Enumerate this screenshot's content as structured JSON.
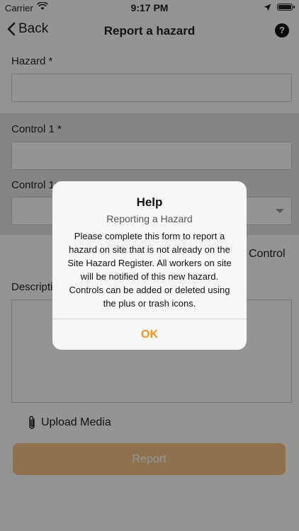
{
  "status_bar": {
    "carrier": "Carrier",
    "time": "9:17 PM"
  },
  "nav": {
    "back_label": "Back",
    "title": "Report a hazard",
    "help_label": "?"
  },
  "form": {
    "hazard_label": "Hazard *",
    "control1_label": "Control 1 *",
    "control1_type_label": "Control 1:",
    "add_control_label": "Control",
    "description_label": "Descripti",
    "upload_label": "Upload Media",
    "report_button": "Report"
  },
  "alert": {
    "title": "Help",
    "subtitle": "Reporting a Hazard",
    "message": "Please complete this form to report a hazard on site that is not already on the Site Hazard Register. All workers on site will be notified of this new hazard. Controls can be added or deleted using the plus or trash icons.",
    "ok_label": "OK"
  },
  "colors": {
    "accent": "#f2931f",
    "report_button": "#f3c586",
    "overlay": "rgba(0,0,0,0.42)"
  }
}
